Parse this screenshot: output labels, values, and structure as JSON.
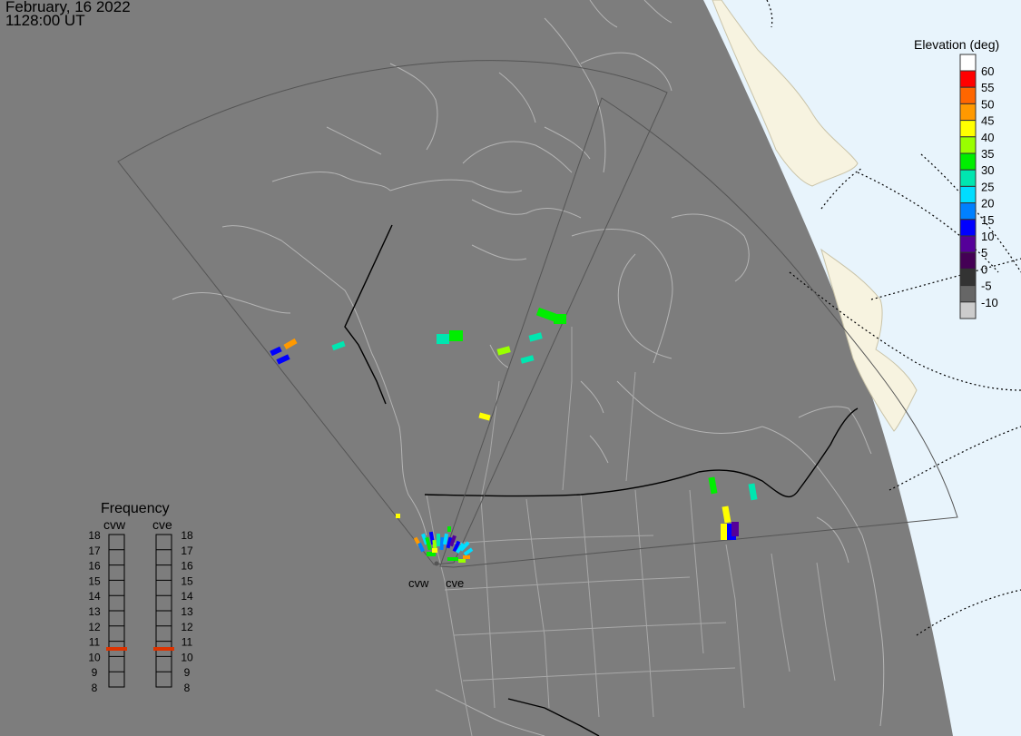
{
  "header": {
    "date": "February, 16 2022",
    "time": "1128:00 UT"
  },
  "elevation_legend": {
    "title": "Elevation (deg)",
    "levels": [
      {
        "label": "60",
        "color": "#ff0000"
      },
      {
        "label": "55",
        "color": "#ff6600"
      },
      {
        "label": "50",
        "color": "#ff9900"
      },
      {
        "label": "45",
        "color": "#ffff00"
      },
      {
        "label": "40",
        "color": "#99ff00"
      },
      {
        "label": "35",
        "color": "#00ee00"
      },
      {
        "label": "30",
        "color": "#00e6b0"
      },
      {
        "label": "25",
        "color": "#00ddff"
      },
      {
        "label": "20",
        "color": "#0080ff"
      },
      {
        "label": "15",
        "color": "#0000ff"
      },
      {
        "label": "10",
        "color": "#550099"
      },
      {
        "label": "5",
        "color": "#440055"
      },
      {
        "label": "0",
        "color": "#333333"
      },
      {
        "label": "-5",
        "color": "#666666"
      },
      {
        "label": "-10",
        "color": "#cccccc"
      }
    ],
    "top_swatch_color": "#ffffff"
  },
  "frequency_legend": {
    "title": "Frequency",
    "radars": [
      "cvw",
      "cve"
    ],
    "ticks": [
      "18",
      "17",
      "16",
      "15",
      "14",
      "13",
      "12",
      "11",
      "10",
      "9",
      "8"
    ],
    "marker_color": "#dd3300",
    "current_frequency_mhz": 10.5
  },
  "radar_sites": [
    {
      "code": "cvw"
    },
    {
      "code": "cve"
    }
  ],
  "colors": {
    "night": "#7d7d7d",
    "ocean_day": "#e8f4fc",
    "land_day": "#f7f3e0",
    "fov_outline": "#555555",
    "border": "#000000",
    "coast": "#b4b4b4"
  }
}
